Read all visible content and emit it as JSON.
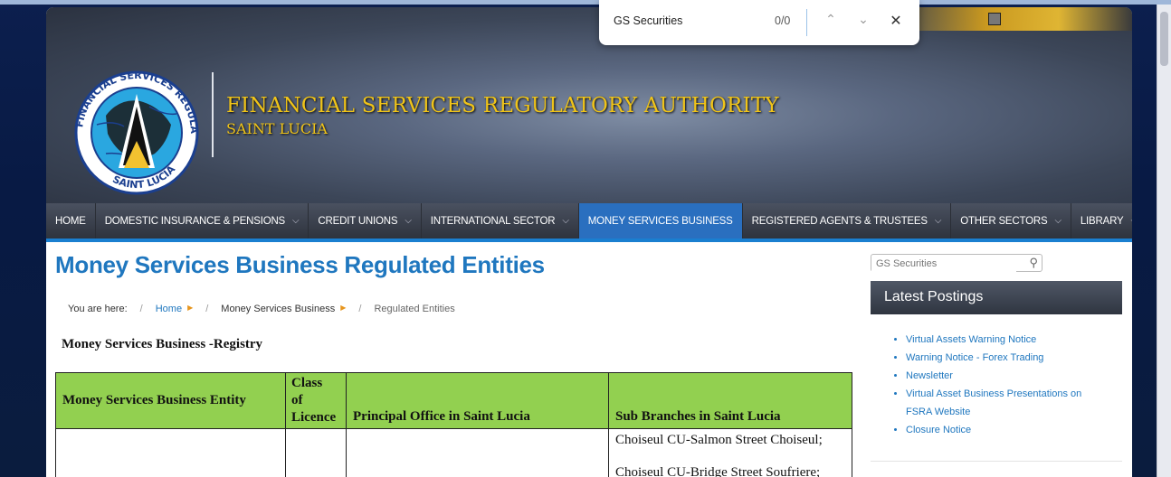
{
  "find_bar": {
    "query": "GS Securities",
    "count": "0/0",
    "prev_icon": "chevron-up-icon",
    "next_icon": "chevron-down-icon",
    "close_icon": "close-icon"
  },
  "header": {
    "logo_text": "FINANCIAL SERVICES REGULATORY AUTHORITY • SAINT LUCIA",
    "title": "FINANCIAL SERVICES  REGULATORY AUTHORITY",
    "subtitle": "SAINT LUCIA"
  },
  "nav": {
    "items": [
      {
        "label": "HOME",
        "dropdown": false
      },
      {
        "label": "DOMESTIC INSURANCE & PENSIONS",
        "dropdown": true
      },
      {
        "label": "CREDIT UNIONS",
        "dropdown": true
      },
      {
        "label": "INTERNATIONAL SECTOR",
        "dropdown": true
      },
      {
        "label": "MONEY SERVICES BUSINESS",
        "dropdown": false,
        "active": true
      },
      {
        "label": "REGISTERED AGENTS & TRUSTEES",
        "dropdown": true
      },
      {
        "label": "OTHER SECTORS",
        "dropdown": true
      },
      {
        "label": "LIBRARY",
        "dropdown": true
      }
    ]
  },
  "page": {
    "title": "Money Services Business Regulated Entities",
    "breadcrumb": {
      "prefix": "You are here:",
      "home": "Home",
      "section": "Money Services Business",
      "current": "Regulated Entities"
    },
    "registry_heading": "Money Services Business -Registry",
    "table": {
      "headers": [
        "Money Services Business Entity",
        "Class of Licence",
        "Principal Office in Saint Lucia",
        "Sub Branches in Saint Lucia"
      ],
      "class_header_lines": [
        "Class",
        "of",
        "Licence"
      ],
      "rows": [
        {
          "entity": "",
          "class": "",
          "principal": "",
          "branches": [
            "Choiseul CU-Salmon Street Choiseul;",
            "Choiseul CU-Bridge Street Soufriere;"
          ]
        }
      ]
    }
  },
  "sidebar": {
    "search_placeholder": "GS Securities",
    "postings_title": "Latest Postings",
    "postings": [
      "Virtual Assets Warning Notice",
      "Warning Notice - Forex Trading",
      "Newsletter",
      "Virtual Asset Business Presentations on FSRA Website",
      "Closure Notice"
    ]
  },
  "colors": {
    "accent_blue": "#1f77bf",
    "nav_active": "#2a6fbf",
    "table_header_green": "#92d050",
    "title_gold": "#f0c419"
  }
}
